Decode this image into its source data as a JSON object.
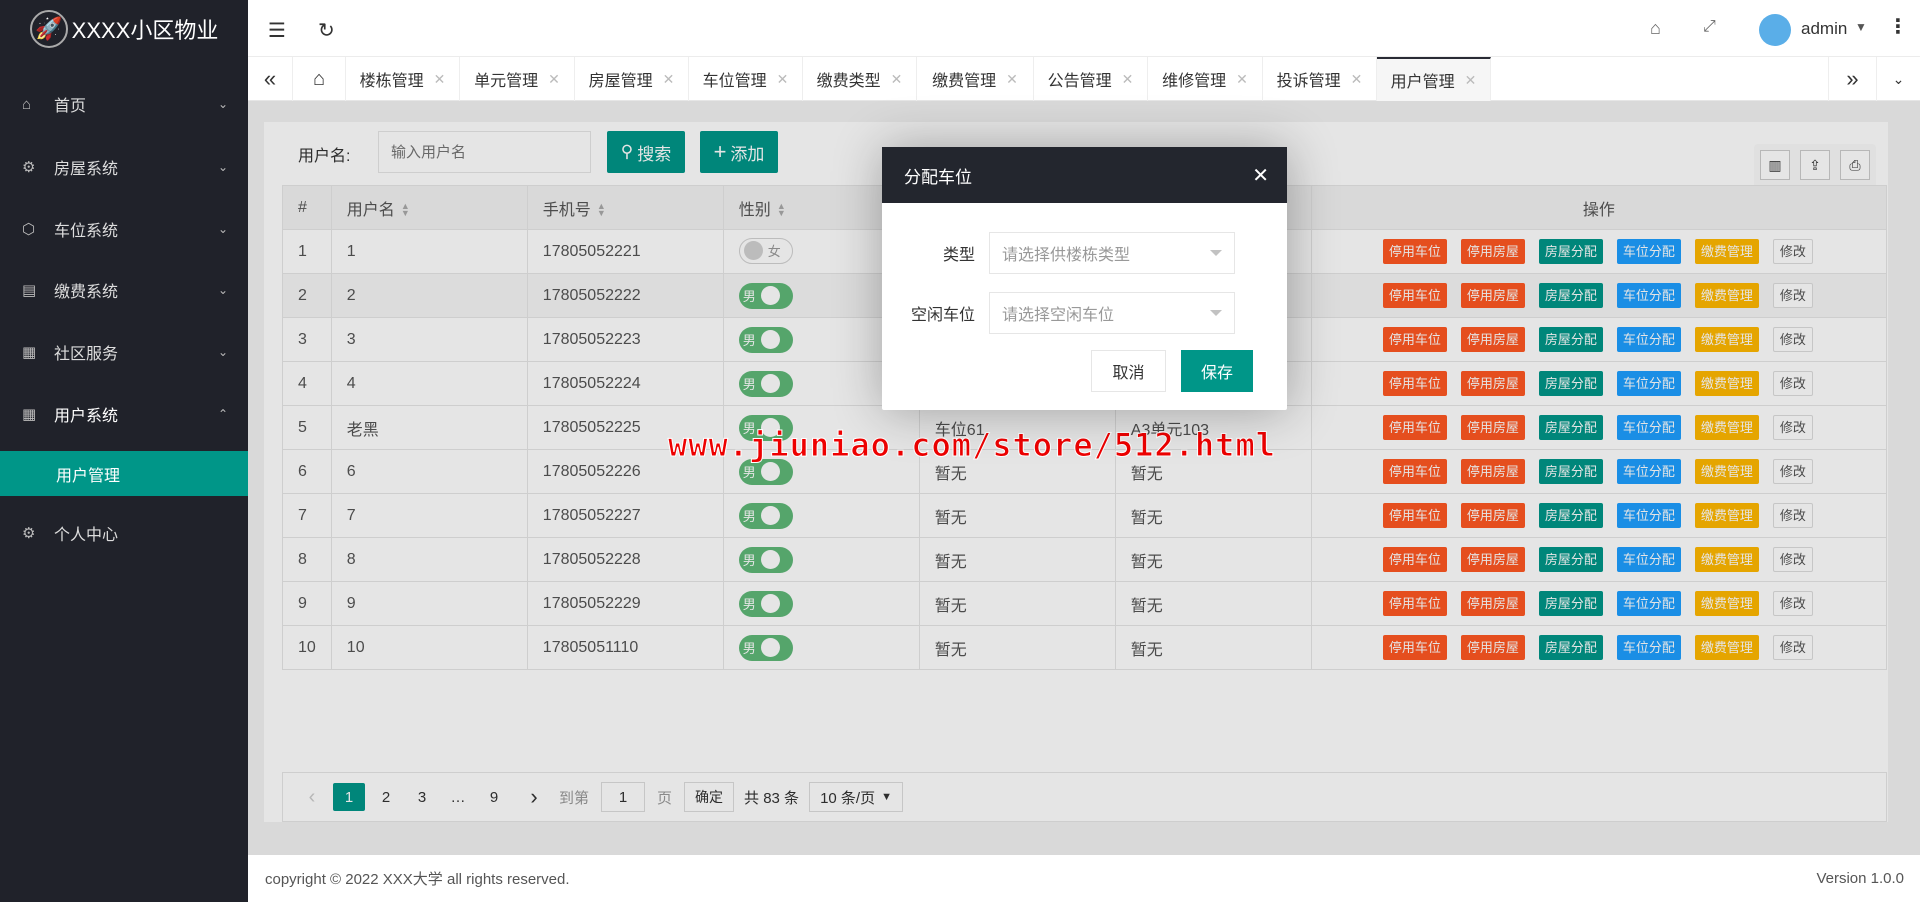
{
  "app": {
    "title": "XXXX小区物业"
  },
  "sidebar": {
    "items": [
      {
        "label": "首页"
      },
      {
        "label": "房屋系统"
      },
      {
        "label": "车位系统"
      },
      {
        "label": "缴费系统"
      },
      {
        "label": "社区服务"
      },
      {
        "label": "用户系统"
      },
      {
        "label": "个人中心"
      }
    ],
    "sub_active": "用户管理"
  },
  "header": {
    "user": "admin"
  },
  "tabs": [
    "楼栋管理",
    "单元管理",
    "房屋管理",
    "车位管理",
    "缴费类型",
    "缴费管理",
    "公告管理",
    "维修管理",
    "投诉管理",
    "用户管理"
  ],
  "search": {
    "label": "用户名:",
    "placeholder": "输入用户名",
    "search_btn": "搜索",
    "add_btn": "添加"
  },
  "table": {
    "headers": [
      "#",
      "用户名",
      "手机号",
      "性别",
      "",
      "",
      "操作"
    ],
    "rows": [
      [
        "1",
        "1",
        "17805052221",
        "女",
        "",
        ""
      ],
      [
        "2",
        "2",
        "17805052222",
        "男",
        "",
        ""
      ],
      [
        "3",
        "3",
        "17805052223",
        "男",
        "",
        ""
      ],
      [
        "4",
        "4",
        "17805052224",
        "男",
        "",
        ""
      ],
      [
        "5",
        "老黑",
        "17805052225",
        "男",
        "车位61",
        "A3单元103"
      ],
      [
        "6",
        "6",
        "17805052226",
        "男",
        "暂无",
        "暂无"
      ],
      [
        "7",
        "7",
        "17805052227",
        "男",
        "暂无",
        "暂无"
      ],
      [
        "8",
        "8",
        "17805052228",
        "男",
        "暂无",
        "暂无"
      ],
      [
        "9",
        "9",
        "17805052229",
        "男",
        "暂无",
        "暂无"
      ],
      [
        "10",
        "10",
        "17805051110",
        "男",
        "暂无",
        "暂无"
      ]
    ],
    "actions": [
      {
        "label": "停用车位",
        "color": "red"
      },
      {
        "label": "停用房屋",
        "color": "red"
      },
      {
        "label": "房屋分配",
        "color": "green"
      },
      {
        "label": "车位分配",
        "color": "blue"
      },
      {
        "label": "缴费管理",
        "color": "yellow"
      },
      {
        "label": "修改",
        "color": "plain"
      }
    ]
  },
  "pagination": {
    "pages": [
      "1",
      "2",
      "3",
      "…",
      "9"
    ],
    "goto_label": "到第",
    "goto_value": "1",
    "page_unit": "页",
    "confirm": "确定",
    "total": "共 83 条",
    "page_size": "10 条/页"
  },
  "modal": {
    "title": "分配车位",
    "type_label": "类型",
    "type_placeholder": "请选择供楼栋类型",
    "slot_label": "空闲车位",
    "slot_placeholder": "请选择空闲车位",
    "cancel": "取消",
    "save": "保存"
  },
  "watermark": "www.jiuniao.com/store/512.html",
  "footer": {
    "copyright": "copyright © 2022 XXX大学 all rights reserved.",
    "version": "Version 1.0.0"
  },
  "colors": {
    "primary": "#009688",
    "sidebar": "#20222a",
    "danger": "#ff5722",
    "info": "#1e9fff",
    "warn": "#ffb800"
  }
}
